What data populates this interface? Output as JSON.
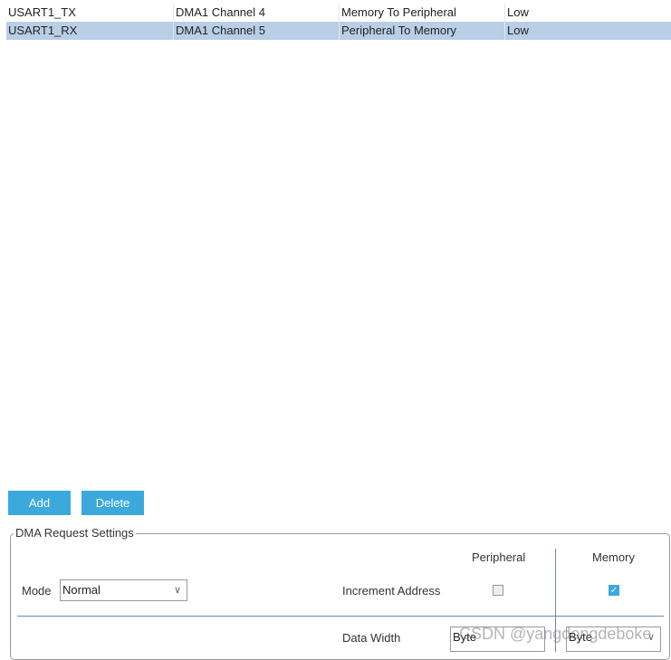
{
  "table": {
    "rows": [
      {
        "name": "USART1_TX",
        "channel": "DMA1 Channel 4",
        "direction": "Memory To Peripheral",
        "priority": "Low",
        "selected": false
      },
      {
        "name": "USART1_RX",
        "channel": "DMA1 Channel 5",
        "direction": "Peripheral To Memory",
        "priority": "Low",
        "selected": true
      }
    ]
  },
  "buttons": {
    "add": "Add",
    "delete": "Delete"
  },
  "settings": {
    "legend": "DMA Request Settings",
    "col_peripheral": "Peripheral",
    "col_memory": "Memory",
    "mode_label": "Mode",
    "mode_value": "Normal",
    "increment_label": "Increment Address",
    "increment_peripheral": false,
    "increment_memory": true,
    "data_width_label": "Data Width",
    "data_width_peripheral": "Byte",
    "data_width_memory": "Byte"
  },
  "watermark": "CSDN @yangdongdeboke",
  "colors": {
    "accent": "#3ca9dd",
    "selected_row": "#b8cfe6",
    "divider": "#6b86c0"
  }
}
